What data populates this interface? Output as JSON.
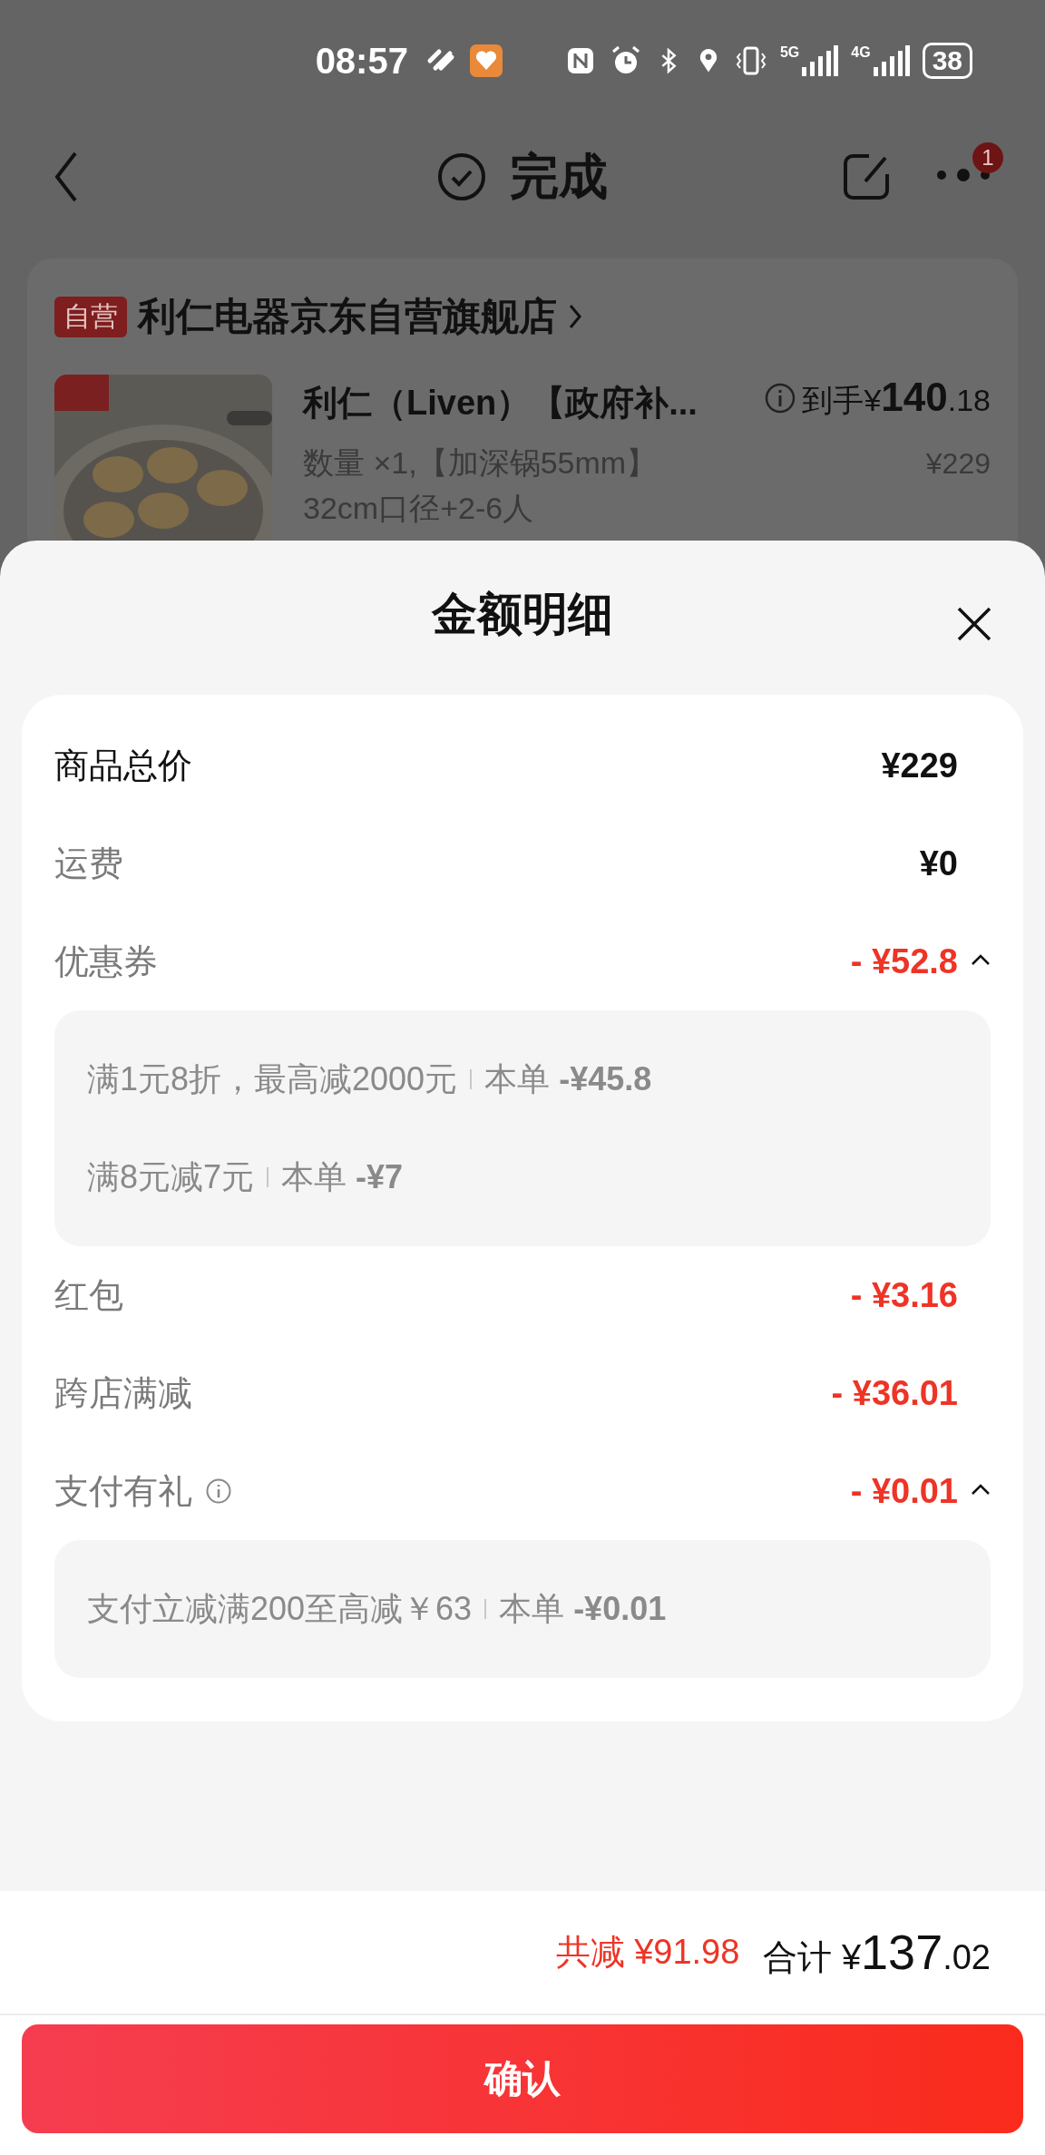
{
  "status_bar": {
    "time": "08:57",
    "network": [
      "5G",
      "4G"
    ],
    "battery": "38"
  },
  "header": {
    "title": "完成",
    "badge": "1"
  },
  "store": {
    "tag": "自营",
    "name": "利仁电器京东自营旗舰店"
  },
  "product": {
    "kind": "picture",
    "title": "利仁（Liven）【政府补...",
    "price_prefix": "到手¥",
    "price_main": "140",
    "price_decimal": ".18",
    "spec": "数量 ×1,【加深锅55mm】",
    "spec_line_2": "32cm口径+2-6人",
    "original_price": "¥229"
  },
  "sheet": {
    "title": "金额明细"
  },
  "rows": [
    {
      "kind": "total",
      "label": "商品总价",
      "value": "¥229"
    },
    {
      "kind": "fee",
      "label": "运费",
      "value": "¥0"
    },
    {
      "kind": "discount",
      "label": "优惠券",
      "value": "- ¥52.8",
      "expanded": true,
      "details": [
        {
          "text": "满1元8折，最高减2000元",
          "note": "本单",
          "amount": "-¥45.8"
        },
        {
          "text": "满8元减7元",
          "note": "本单",
          "amount": "-¥7"
        }
      ]
    },
    {
      "kind": "discount",
      "label": "红包",
      "value": "- ¥3.16"
    },
    {
      "kind": "discount",
      "label": "跨店满减",
      "value": "- ¥36.01"
    },
    {
      "kind": "discount",
      "label": "支付有礼",
      "value": "- ¥0.01",
      "info_icon": true,
      "expanded": true,
      "details": [
        {
          "text": "支付立减满200至高减￥63",
          "note": "本单",
          "amount": "-¥0.01"
        }
      ]
    }
  ],
  "footer": {
    "saved_label": "共减",
    "saved": "¥91.98",
    "total_label": "合计",
    "total_prefix": "¥",
    "total_main": "137",
    "total_decimal": ".02"
  },
  "confirm_button": "确认"
}
